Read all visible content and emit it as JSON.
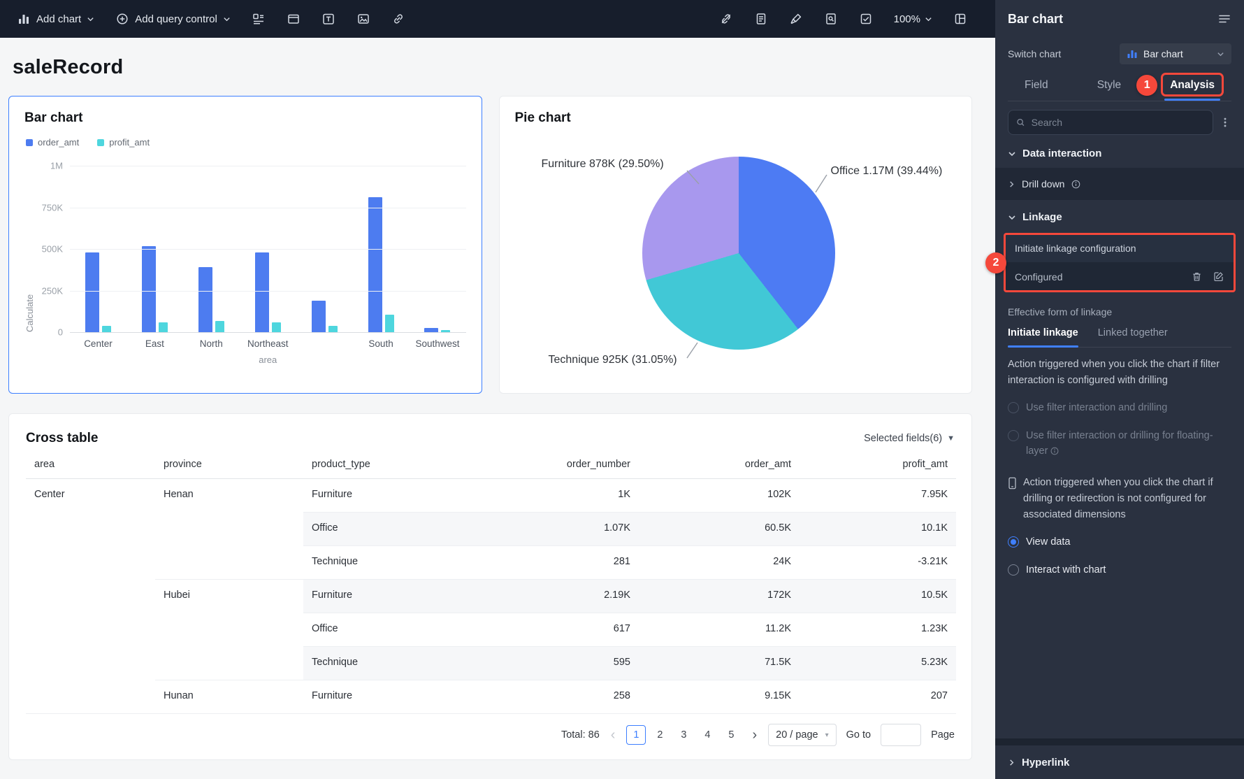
{
  "toolbar": {
    "add_chart": "Add chart",
    "add_query_control": "Add query control",
    "zoom": "100%"
  },
  "canvas": {
    "title": "saleRecord"
  },
  "bar_card": {
    "title": "Bar chart"
  },
  "pie_card": {
    "title": "Pie chart",
    "labels": {
      "furniture": "Furniture 878K (29.50%)",
      "office": "Office 1.17M (39.44%)",
      "technique": "Technique 925K (31.05%)"
    }
  },
  "chart_data": [
    {
      "type": "bar",
      "title": "Bar chart",
      "categories": [
        "Center",
        "East",
        "North",
        "Northeast",
        "",
        "South",
        "Southwest"
      ],
      "series": [
        {
          "name": "order_amt",
          "color": "#4d7cf0",
          "values_k": [
            480,
            515,
            390,
            480,
            190,
            810,
            25
          ]
        },
        {
          "name": "profit_amt",
          "color": "#4ed6de",
          "values_k": [
            38,
            57,
            67,
            57,
            38,
            105,
            14
          ]
        }
      ],
      "ylabel": "Calculate",
      "xlabel": "area",
      "y_ticks": [
        "1M",
        "750K",
        "500K",
        "250K",
        "0"
      ],
      "ylim_k": [
        0,
        1000
      ],
      "grid": true,
      "legend_position": "top-left"
    },
    {
      "type": "pie",
      "title": "Pie chart",
      "slices": [
        {
          "label": "Office",
          "value": "1.17M",
          "pct": 39.44,
          "color": "#4d7bf3"
        },
        {
          "label": "Technique",
          "value": "925K",
          "pct": 31.05,
          "color": "#41c8d6"
        },
        {
          "label": "Furniture",
          "value": "878K",
          "pct": 29.5,
          "color": "#a898ee"
        }
      ]
    },
    {
      "type": "table",
      "title": "Cross table",
      "columns": [
        "area",
        "province",
        "product_type",
        "order_number",
        "order_amt",
        "profit_amt"
      ],
      "rows": [
        {
          "area": "Center",
          "province": "Henan",
          "product_type": "Furniture",
          "order_number": "1K",
          "order_amt": "102K",
          "profit_amt": "7.95K"
        },
        {
          "area": "",
          "province": "",
          "product_type": "Office",
          "order_number": "1.07K",
          "order_amt": "60.5K",
          "profit_amt": "10.1K"
        },
        {
          "area": "",
          "province": "",
          "product_type": "Technique",
          "order_number": "281",
          "order_amt": "24K",
          "profit_amt": "-3.21K"
        },
        {
          "area": "",
          "province": "Hubei",
          "product_type": "Furniture",
          "order_number": "2.19K",
          "order_amt": "172K",
          "profit_amt": "10.5K"
        },
        {
          "area": "",
          "province": "",
          "product_type": "Office",
          "order_number": "617",
          "order_amt": "11.2K",
          "profit_amt": "1.23K"
        },
        {
          "area": "",
          "province": "",
          "product_type": "Technique",
          "order_number": "595",
          "order_amt": "71.5K",
          "profit_amt": "5.23K"
        },
        {
          "area": "",
          "province": "Hunan",
          "product_type": "Furniture",
          "order_number": "258",
          "order_amt": "9.15K",
          "profit_amt": "207"
        }
      ]
    }
  ],
  "cross_card": {
    "title": "Cross table",
    "selected_fields": "Selected fields(6)",
    "pagination": {
      "total": "Total: 86",
      "pages": [
        "1",
        "2",
        "3",
        "4",
        "5"
      ],
      "current": "1",
      "page_size": "20 / page",
      "goto": "Go to",
      "page": "Page"
    }
  },
  "panel": {
    "title": "Bar chart",
    "switch_chart": "Switch chart",
    "chart_type": "Bar chart",
    "tabs": [
      "Field",
      "Style",
      "Analysis"
    ],
    "active_tab": "Analysis",
    "search_placeholder": "Search",
    "section_data_interaction": "Data interaction",
    "drill_down": "Drill down",
    "section_linkage": "Linkage",
    "initiate_config": "Initiate linkage configuration",
    "configured": "Configured",
    "effective_form": "Effective form of linkage",
    "linkage_tabs": [
      "Initiate linkage",
      "Linked together"
    ],
    "active_linkage_tab": "Initiate linkage",
    "para_filter": "Action triggered when you click the chart if filter interaction is configured with drilling",
    "radio_filter_and": "Use filter interaction and drilling",
    "radio_filter_or": "Use filter interaction or drilling for floating-layer",
    "para_drill": "Action triggered when you click the chart if drilling or redirection is not configured for associated dimensions",
    "radio_view_data": "View data",
    "radio_interact": "Interact with chart",
    "section_hyperlink": "Hyperlink"
  },
  "annotations": {
    "step1": "1",
    "step2": "2"
  }
}
